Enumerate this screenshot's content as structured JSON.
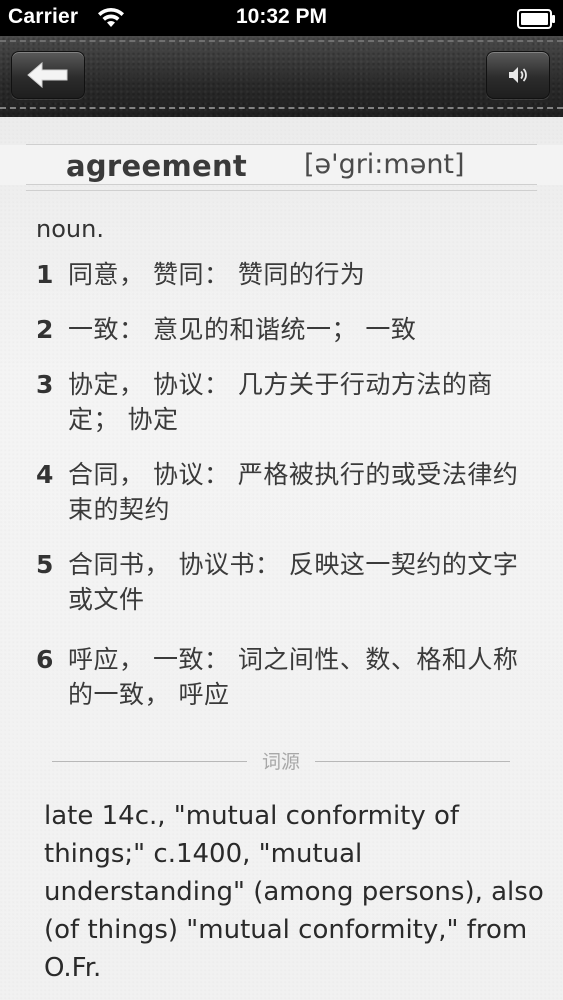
{
  "status_bar": {
    "carrier": "Carrier",
    "time": "10:32 PM"
  },
  "nav": {
    "back_icon": "back-arrow-icon",
    "speaker_icon": "speaker-icon"
  },
  "entry": {
    "headword": "agreement",
    "phonetic": "[ə'gri:mənt]",
    "part_of_speech": "noun.",
    "definitions": [
      {
        "num": "1",
        "text": "同意， 赞同： 赞同的行为"
      },
      {
        "num": "2",
        "text": "一致： 意见的和谐统一； 一致"
      },
      {
        "num": "3",
        "text": "协定， 协议： 几方关于行动方法的商定； 协定"
      },
      {
        "num": "4",
        "text": "合同， 协议： 严格被执行的或受法律约束的契约"
      },
      {
        "num": "5",
        "text": "合同书， 协议书： 反映这一契约的文字或文件"
      },
      {
        "num": "6",
        "text": "呼应， 一致： 词之间性、数、格和人称的一致， 呼应"
      }
    ],
    "etymology_label": "词源",
    "etymology_text": "late 14c., \"mutual conformity of things;\" c.1400, \"mutual understanding\" (among persons), also (of things) \"mutual conformity,\" from O.Fr."
  },
  "colors": {
    "status_bar_bg": "#000000",
    "nav_leather": "#2f2f2f",
    "paper_bg": "#f2f2f2",
    "text": "#333333",
    "divider_label": "#a8a8a8"
  }
}
